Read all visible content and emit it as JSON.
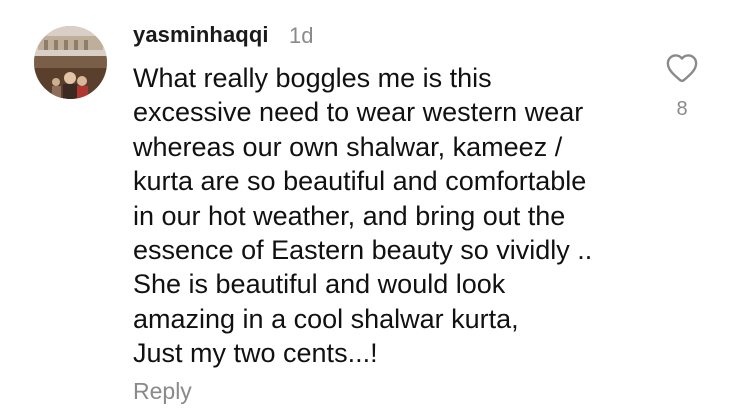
{
  "comment": {
    "username": "yasminhaqqi",
    "timestamp": "1d",
    "text_lines": [
      "What really boggles me is this",
      "excessive need to wear western wear",
      "whereas our own shalwar, kameez /",
      "kurta are so beautiful and comfortable",
      "in our hot weather, and bring out the",
      "essence of Eastern beauty so vividly ..",
      "She is beautiful and would look",
      "amazing in a cool shalwar kurta,",
      "Just my two cents...!"
    ],
    "reply_label": "Reply",
    "like_count": "8",
    "like_icon": "heart-outline-icon"
  },
  "colors": {
    "text": "#111111",
    "muted": "#8a8a8a",
    "background": "#ffffff"
  }
}
